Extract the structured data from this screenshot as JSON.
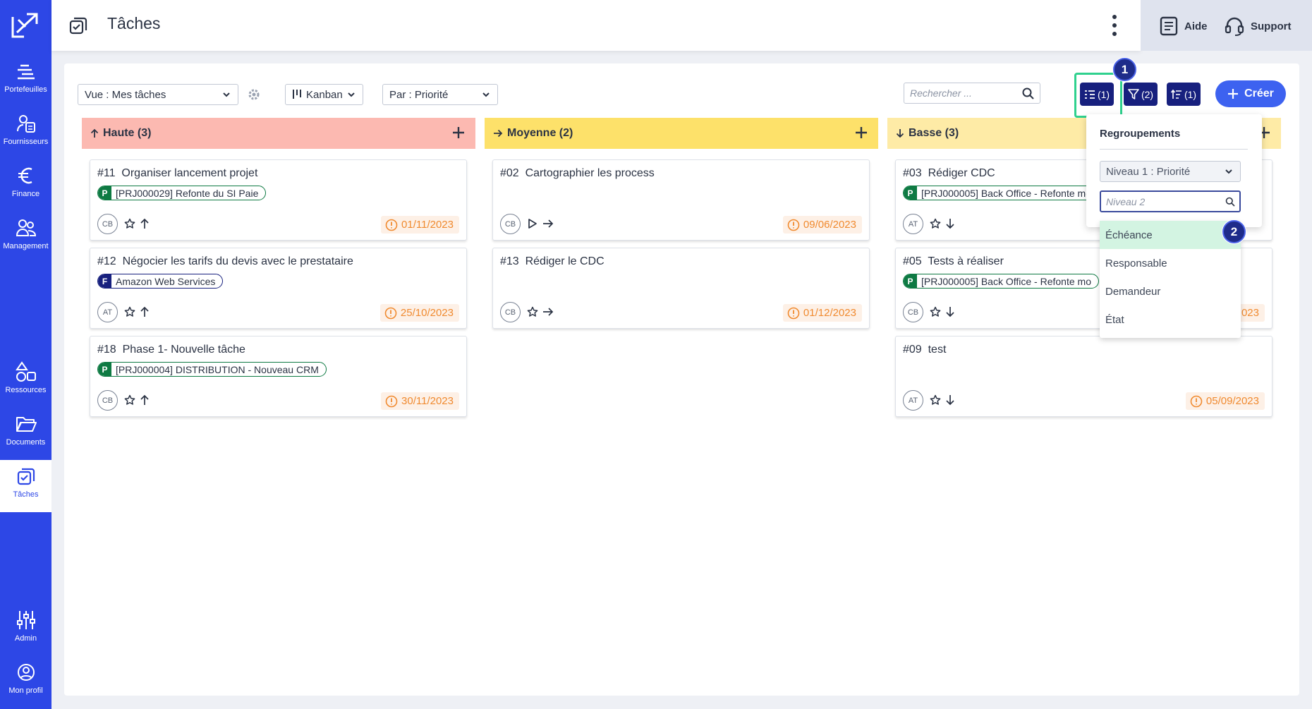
{
  "sidebar": {
    "items": [
      {
        "label": "Portefeuilles",
        "icon": "portfolio-icon"
      },
      {
        "label": "Fournisseurs",
        "icon": "suppliers-icon"
      },
      {
        "label": "Finance",
        "icon": "euro-icon"
      },
      {
        "label": "Management",
        "icon": "people-icon"
      },
      {
        "label": "Ressources",
        "icon": "shapes-icon"
      },
      {
        "label": "Documents",
        "icon": "folder-icon"
      },
      {
        "label": "Tâches",
        "icon": "tasks-icon"
      },
      {
        "label": "Admin",
        "icon": "sliders-icon"
      },
      {
        "label": "Mon profil",
        "icon": "user-circle-icon"
      }
    ],
    "active": "Tâches"
  },
  "header": {
    "title": "Tâches",
    "help_label": "Aide",
    "support_label": "Support"
  },
  "toolbar": {
    "view_select": "Vue : Mes tâches",
    "layout_select": "Kanban",
    "group_select": "Par : Priorité",
    "search_placeholder": "Rechercher ...",
    "group_btn": "(1)",
    "filter_btn": "(2)",
    "sort_btn": "(1)",
    "create_label": "Créer"
  },
  "steps": [
    "1",
    "2"
  ],
  "columns": [
    {
      "name": "Haute",
      "count": "(3)",
      "color": "#fcb9b1",
      "cards": [
        {
          "id": "#11",
          "title": "Organiser lancement projet",
          "tag_letter": "P",
          "tag": "[PRJ000029] Refonte du SI Paie",
          "assignee": "CB",
          "due": "01/11/2023"
        },
        {
          "id": "#12",
          "title": "Négocier les tarifs du devis avec le prestataire",
          "tag_letter": "F",
          "tag": "Amazon Web Services",
          "assignee": "AT",
          "due": "25/10/2023"
        },
        {
          "id": "#18",
          "title": "Phase 1- Nouvelle tâche",
          "tag_letter": "P",
          "tag": "[PRJ000004] DISTRIBUTION - Nouveau CRM",
          "assignee": "CB",
          "due": "30/11/2023"
        }
      ]
    },
    {
      "name": "Moyenne",
      "count": "(2)",
      "color": "#fde16a",
      "cards": [
        {
          "id": "#02",
          "title": "Cartographier les process",
          "assignee": "CB",
          "due": "09/06/2023"
        },
        {
          "id": "#13",
          "title": "Rédiger le CDC",
          "assignee": "CB",
          "due": "01/12/2023"
        }
      ]
    },
    {
      "name": "Basse",
      "count": "(3)",
      "color": "#feeba6",
      "cards": [
        {
          "id": "#03",
          "title": "Rédiger CDC",
          "tag_letter": "P",
          "tag": "[PRJ000005] Back Office - Refonte mo",
          "assignee": "AT"
        },
        {
          "id": "#05",
          "title": "Tests à réaliser",
          "tag_letter": "P",
          "tag": "[PRJ000005] Back Office - Refonte mo",
          "assignee": "CB",
          "due": "023"
        },
        {
          "id": "#09",
          "title": "test",
          "assignee": "AT",
          "due": "05/09/2023"
        }
      ]
    }
  ],
  "grouping_popup": {
    "title": "Regroupements",
    "level1": "Niveau 1 : Priorité",
    "level2_placeholder": "Niveau 2",
    "options": [
      "Échéance",
      "Responsable",
      "Demandeur",
      "État"
    ],
    "highlighted": "Échéance"
  },
  "colors": {
    "sidebar": "#2d47e6",
    "accent_dark": "#17207e",
    "create": "#3d62f0",
    "highlight_frame": "#2fd18e",
    "due": "#f08a2f",
    "tag_project": "#0e7a43",
    "tag_supplier": "#17207e"
  }
}
